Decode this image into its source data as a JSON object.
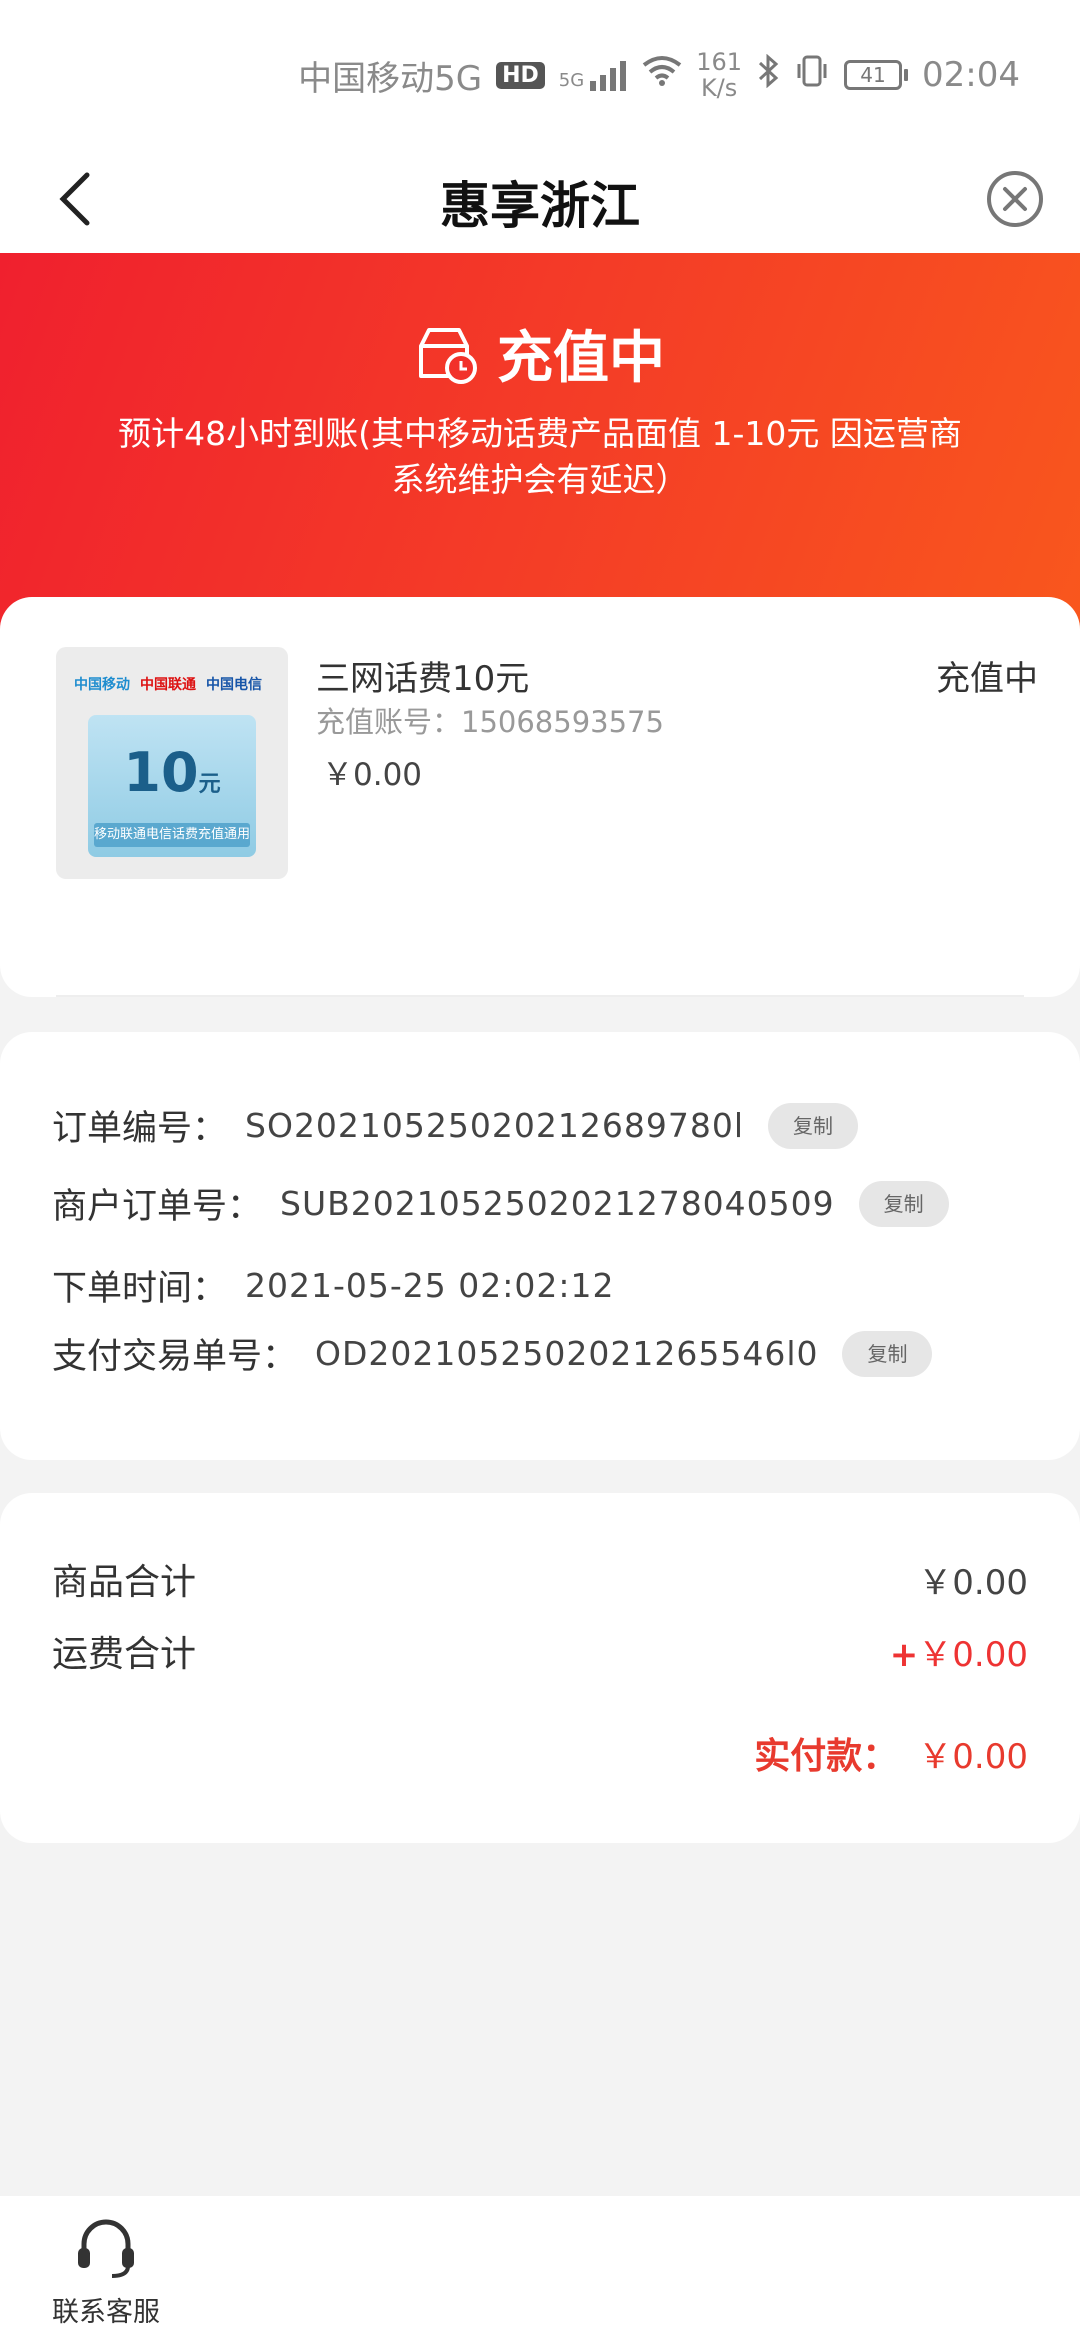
{
  "status_bar": {
    "carrier": "中国移动5G",
    "hd": "HD",
    "network": "5G",
    "speed_value": "161",
    "speed_unit": "K/s",
    "battery": "41",
    "time": "02:04"
  },
  "nav": {
    "title": "惠享浙江"
  },
  "banner": {
    "status": "充值中",
    "note": "预计48小时到账(其中移动话费产品面值 1-10元 因运营商系统维护会有延迟）",
    "accent_start": "#f0202e",
    "accent_end": "#f9571d"
  },
  "product": {
    "thumb": {
      "logo_cmcc": "中国移动",
      "logo_cu": "中国联通",
      "logo_ct": "中国电信",
      "amount": "10",
      "unit": "元",
      "caption": "移动联通电信话费充值通用"
    },
    "name": "三网话费10元",
    "status": "充值中",
    "account": "充值账号：15068593575",
    "price": "￥0.00"
  },
  "order": {
    "order_no_label": "订单编号：",
    "order_no": "SO20210525020212689780l",
    "merchant_no_label": "商户订单号：",
    "merchant_no": "SUB2021052502021278040509",
    "time_label": "下单时间：",
    "time": "2021-05-25 02:02:12",
    "pay_no_label": "支付交易单号：",
    "pay_no": "OD2021052502021265546l0",
    "copy_label": "复制"
  },
  "totals": {
    "goods_label": "商品合计",
    "goods_value": "￥0.00",
    "freight_label": "运费合计",
    "freight_plus": "+",
    "freight_value": "￥0.00",
    "paid_label": "实付款：",
    "paid_value": "￥0.00",
    "accent": "#e83a2e"
  },
  "bottom": {
    "service_label": "联系客服"
  }
}
